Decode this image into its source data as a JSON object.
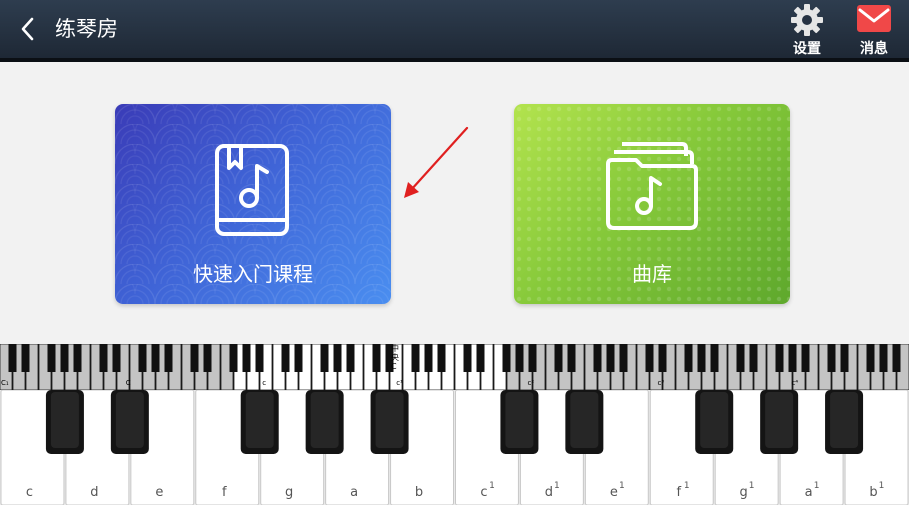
{
  "header": {
    "title": "练琴房",
    "settings_label": "设置",
    "messages_label": "消息"
  },
  "cards": {
    "course_label": "快速入门课程",
    "library_label": "曲库"
  },
  "mini_keyboard": {
    "middle_c_label": "中\n央\nC",
    "octave_labels": [
      "C₁",
      "C",
      "c",
      "c¹",
      "c²",
      "c³",
      "c⁴"
    ]
  },
  "main_keyboard": {
    "white_keys": [
      "c",
      "d",
      "e",
      "f",
      "g",
      "a",
      "b",
      "c",
      "d",
      "e",
      "f",
      "g",
      "a",
      "b"
    ],
    "superscripts": [
      "",
      "",
      "",
      "",
      "",
      "",
      "",
      "1",
      "1",
      "1",
      "1",
      "1",
      "1",
      "1"
    ]
  },
  "colors": {
    "header_bg": "#263242",
    "course_card": "#3f63d6",
    "library_card": "#86c93a",
    "messages_icon": "#f04848",
    "annotation_arrow": "#e02020"
  }
}
